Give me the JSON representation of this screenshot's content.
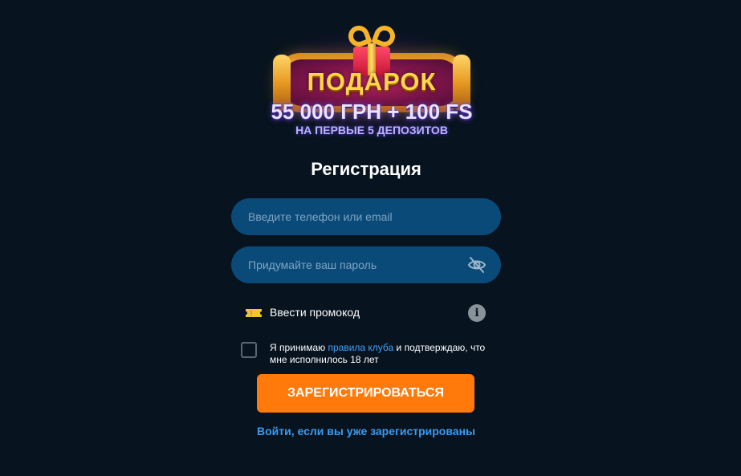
{
  "promo_banner": {
    "title": "ПОДАРОК",
    "amount": "55 000 ГРН + 100 FS",
    "subtitle": "НА ПЕРВЫЕ 5 ДЕПОЗИТОВ",
    "icon": "gift-icon"
  },
  "form": {
    "title": "Регистрация",
    "phone_placeholder": "Введите телефон или email",
    "phone_value": "",
    "password_placeholder": "Придумайте ваш пароль",
    "password_value": "",
    "password_visibility_icon": "eye-off-icon",
    "promo_code_label": "Ввести промокод",
    "promo_code_icon": "ticket-icon",
    "info_icon": "info-icon",
    "terms": {
      "checked": false,
      "prefix": "Я принимаю ",
      "link_text": "правила клуба",
      "suffix": " и подтверждаю, что мне исполнилось 18 лет"
    },
    "register_label": "ЗАРЕГИСТРИРОВАТЬСЯ",
    "login_link": "Войти, если вы уже зарегистрированы"
  },
  "colors": {
    "background": "#07131e",
    "field": "#0a4a78",
    "accent_button": "#ff7a0a",
    "link": "#3a9bf0"
  }
}
